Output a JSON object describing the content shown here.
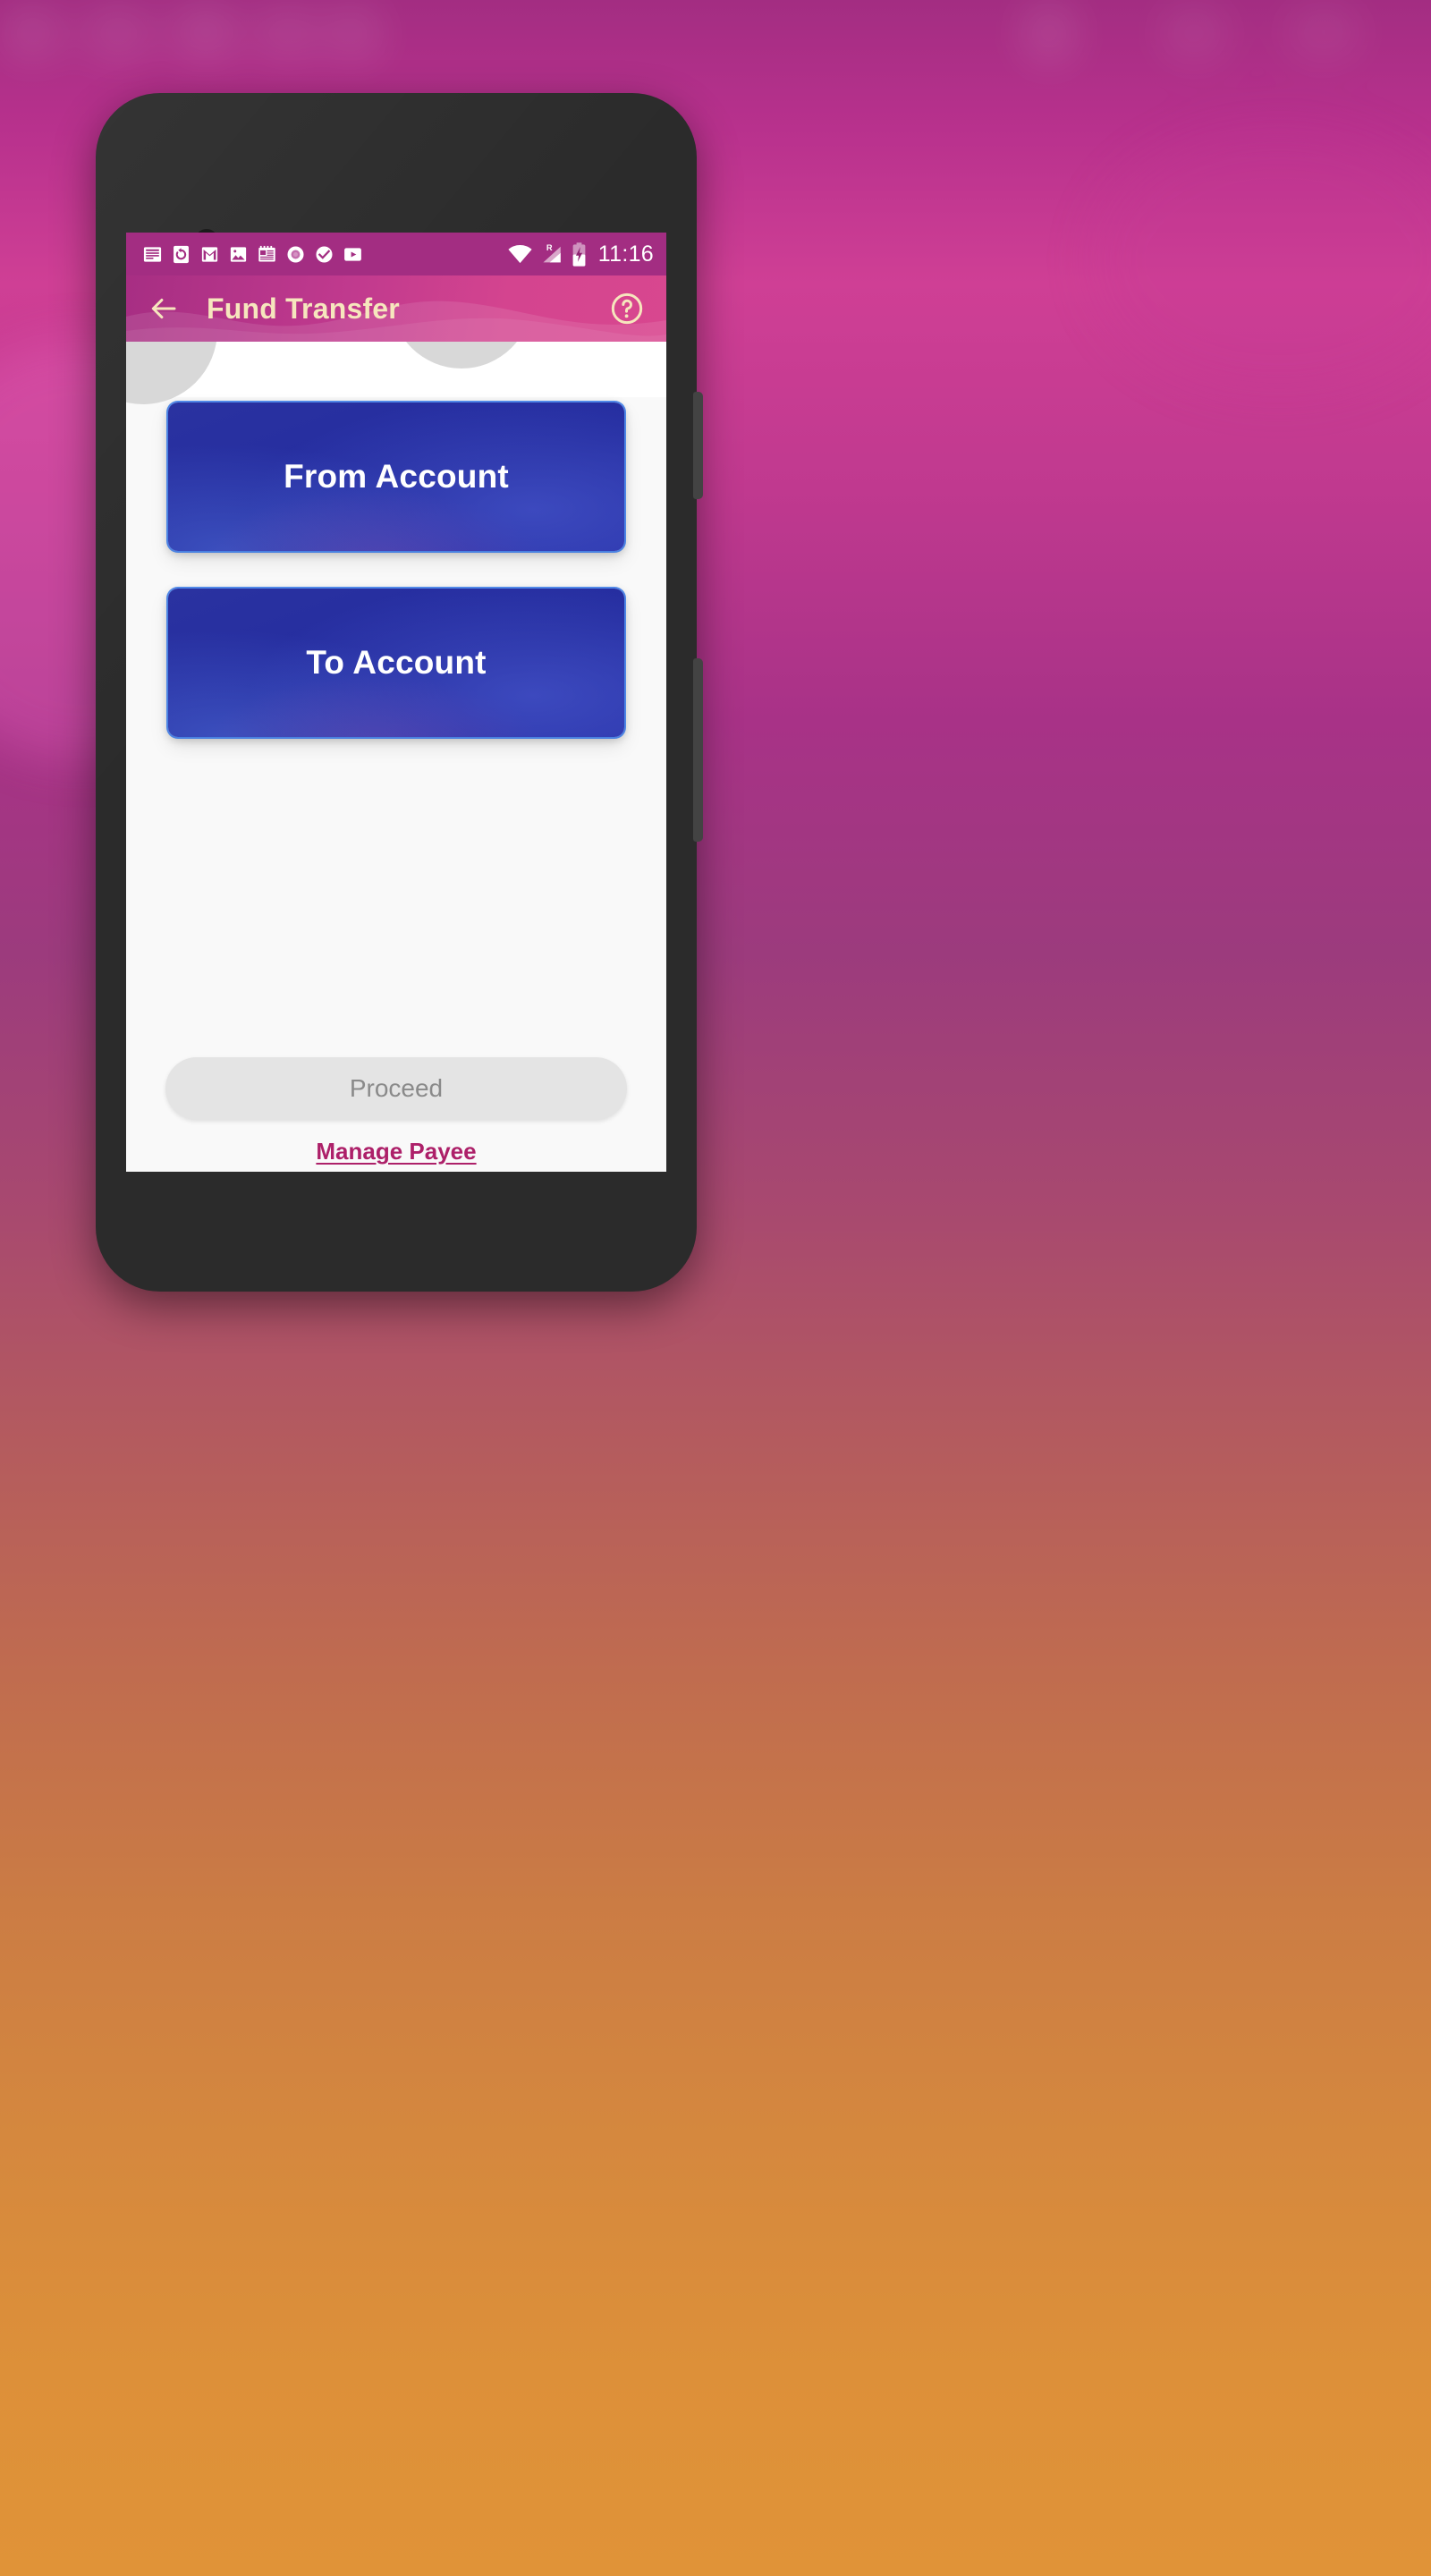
{
  "background": {
    "description": "blurred wallpaper of an underlying screenshot",
    "top_color": "#a32d82",
    "mid_color": "#b45b5e",
    "bottom_color": "#dd9039"
  },
  "device": {
    "frame_color": "#2b2b2b",
    "camera_icon": "front-camera-dot",
    "speaker_icon": "earpiece-speaker-grille",
    "sensor_icon": "proximity-sensor-pill",
    "side_buttons": [
      "volume-rocker",
      "power-button"
    ]
  },
  "status_bar": {
    "background": "#a32d82",
    "time": "11:16",
    "notification_icons": [
      "news-article-icon",
      "backup-sync-icon",
      "gmail-icon",
      "photos-icon",
      "calendar-news-icon",
      "record-circle-icon",
      "check-circle-icon",
      "youtube-icon"
    ],
    "system_icons": [
      "wifi-icon",
      "cellular-signal-roaming-icon",
      "battery-charging-icon"
    ],
    "roaming_label": "R"
  },
  "app_bar": {
    "title": "Fund Transfer",
    "title_color": "#f6e6bd",
    "back_icon": "back-arrow-icon",
    "help_icon": "help-circle-icon",
    "background_start": "#a72e83",
    "background_end": "#d8478f"
  },
  "content": {
    "buttons": [
      {
        "label": "From Account",
        "enabled": true,
        "color": "#262ea0"
      },
      {
        "label": "To Account",
        "enabled": true,
        "color": "#262ea0"
      }
    ],
    "proceed": {
      "label": "Proceed",
      "enabled": false,
      "background": "#e4e4e4",
      "text_color": "#8a8a8a"
    },
    "manage_payee": {
      "label": "Manage Payee",
      "color": "#ad2069"
    },
    "decor": [
      "grey-circle-decor-left",
      "grey-circle-decor-right"
    ]
  }
}
